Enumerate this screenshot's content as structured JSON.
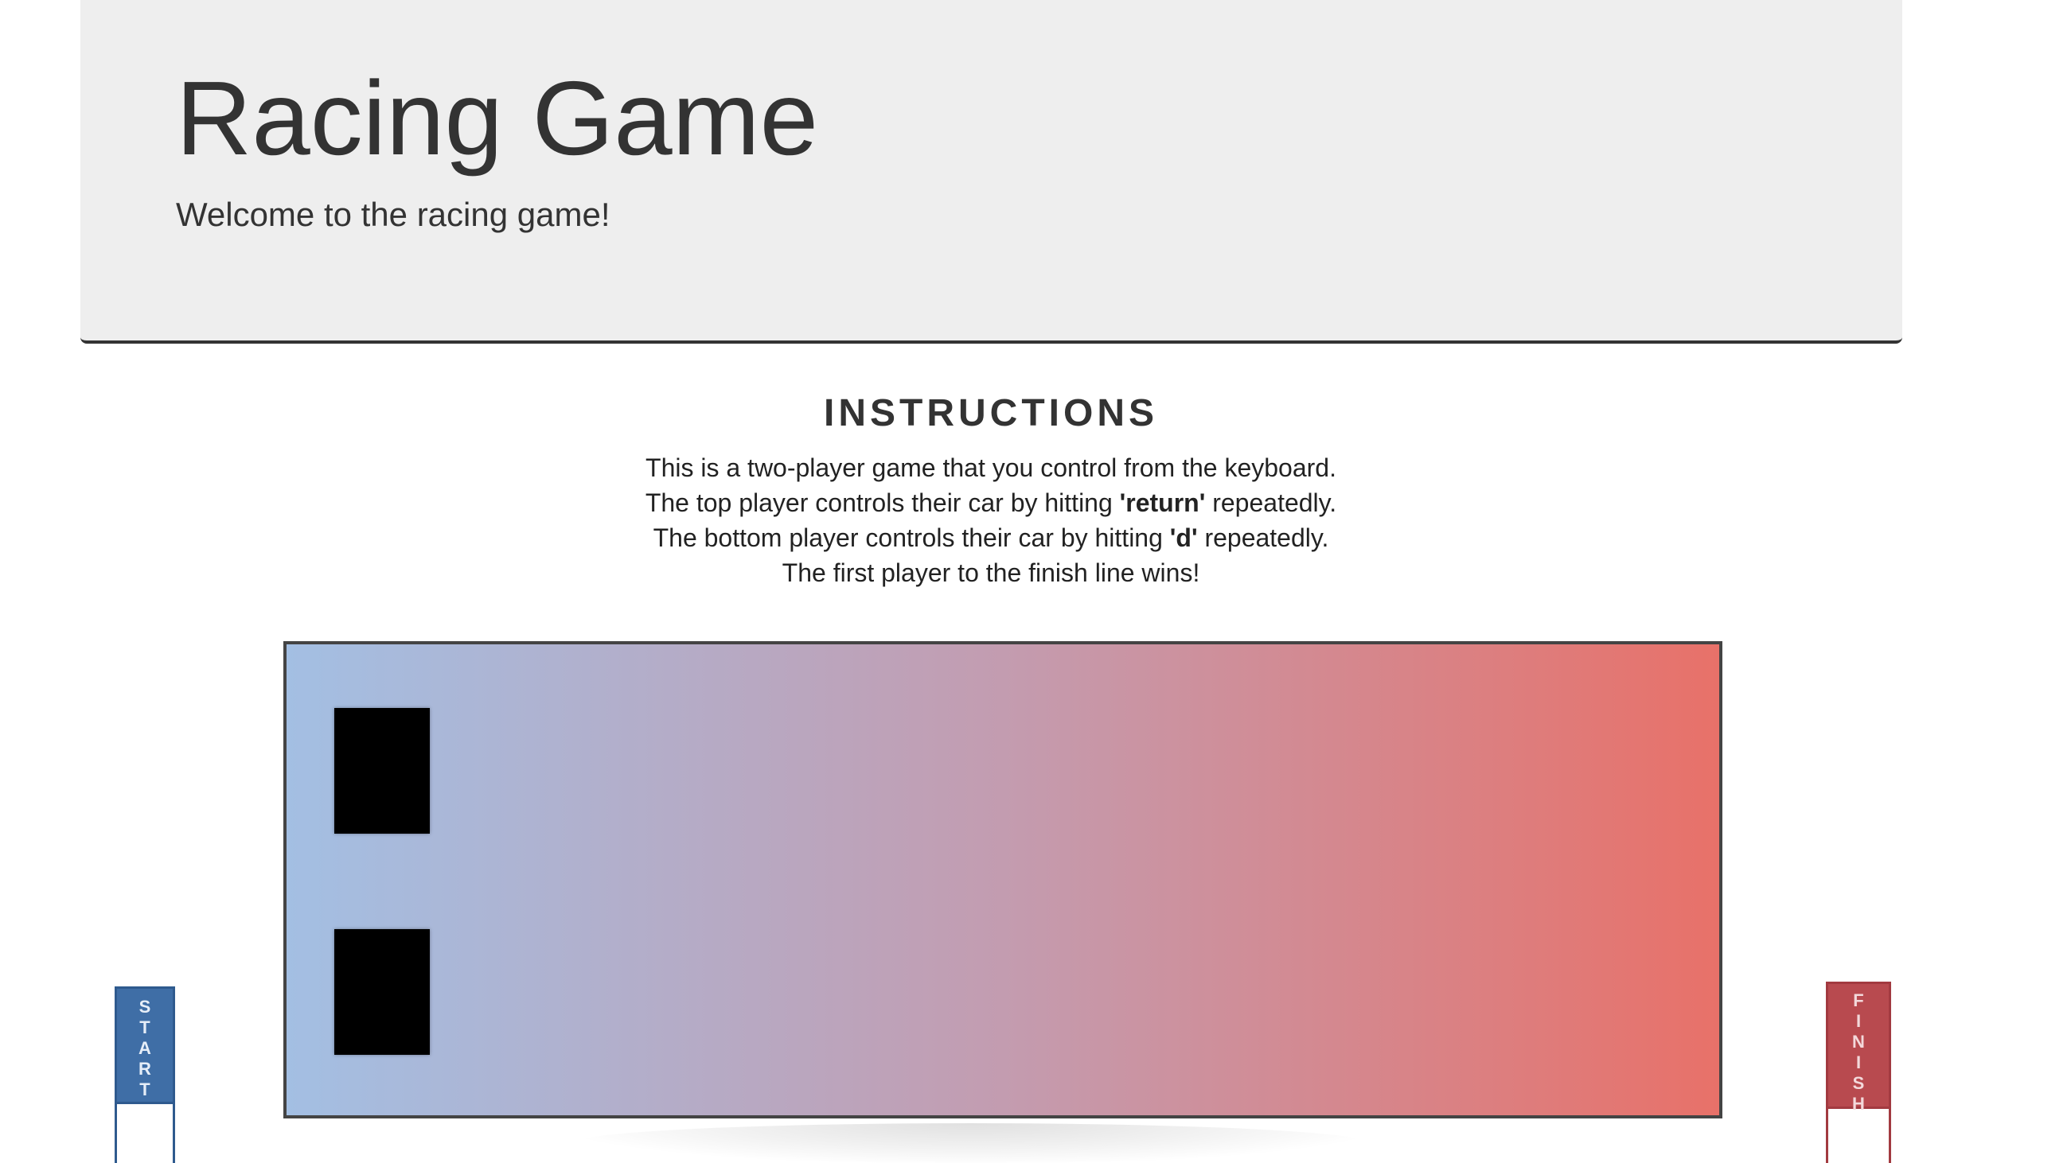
{
  "header": {
    "title": "Racing Game",
    "subtitle": "Welcome to the racing game!"
  },
  "instructions": {
    "heading": "INSTRUCTIONS",
    "line1": "This is a two-player game that you control from the keyboard.",
    "line2_before": "The top player controls their car by hitting ",
    "line2_key": "'return'",
    "line2_after": " repeatedly.",
    "line3_before": "The bottom player controls their car by hitting ",
    "line3_key": "'d'",
    "line3_after": " repeatedly.",
    "line4": "The first player to the finish line wins!"
  },
  "track": {
    "gradient_start_color": "#a3bfe3",
    "gradient_end_color": "#e87169",
    "cars": [
      {
        "player": "top",
        "color": "#000000"
      },
      {
        "player": "bottom",
        "color": "#000000"
      }
    ]
  },
  "flags": {
    "start": {
      "letters": [
        "S",
        "T",
        "A",
        "R",
        "T"
      ],
      "color": "#3f6ea6"
    },
    "finish": {
      "letters": [
        "F",
        "I",
        "N",
        "I",
        "S",
        "H"
      ],
      "color": "#b84a4f"
    }
  }
}
